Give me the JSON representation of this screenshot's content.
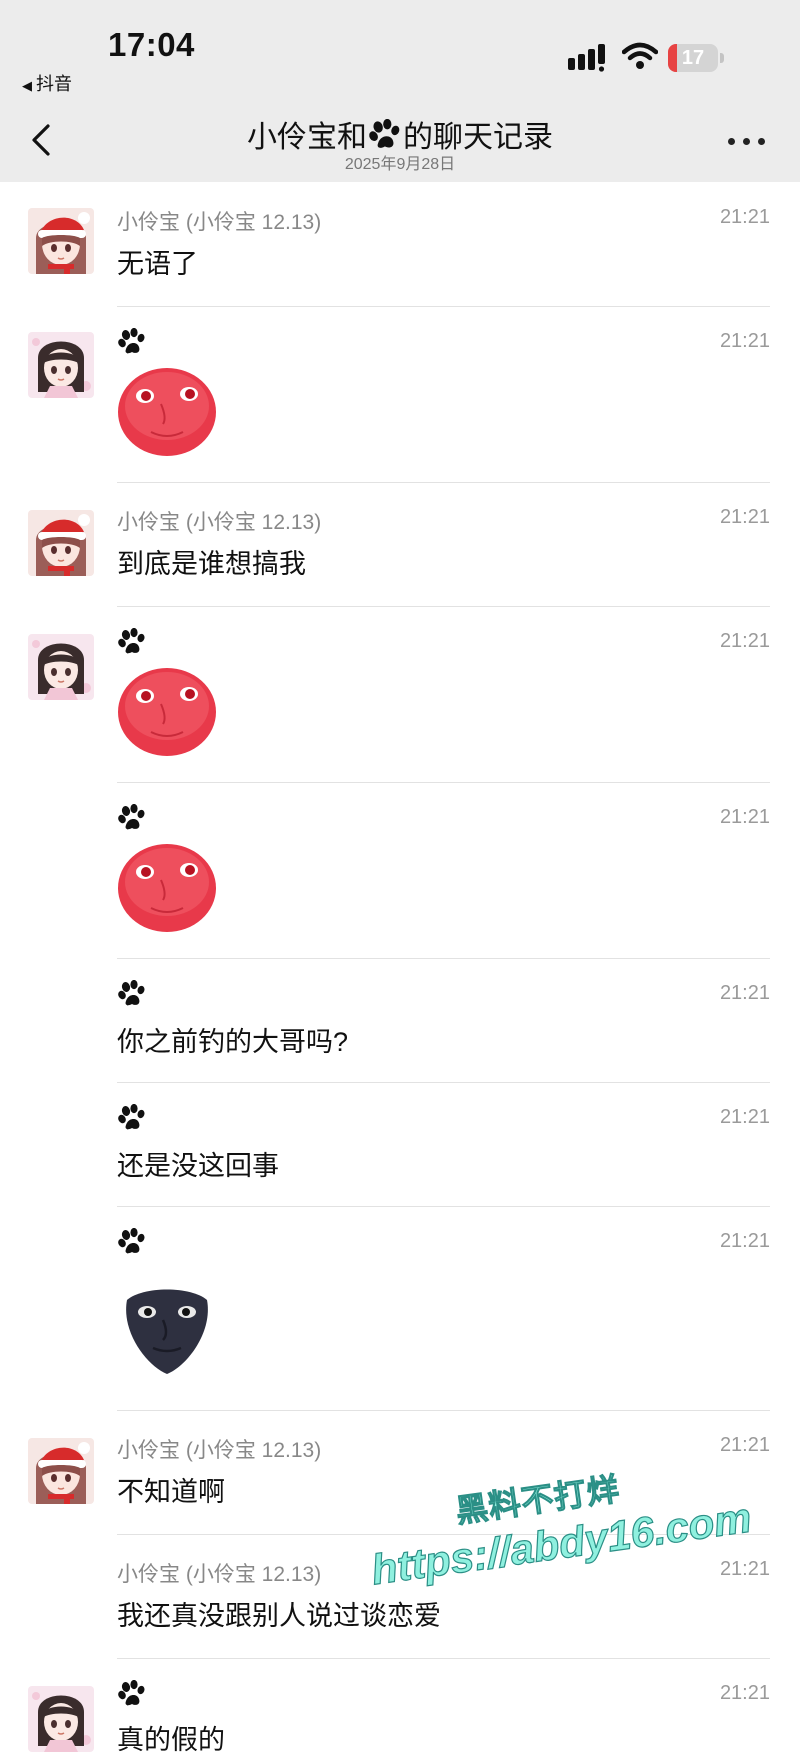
{
  "status_bar": {
    "time": "17:04",
    "back_app": "抖音",
    "battery": "17"
  },
  "nav": {
    "title_prefix": "小伶宝和",
    "title_suffix": "的聊天记录",
    "subtitle": "2025年9月28日"
  },
  "messages": [
    {
      "sender": "小伶宝 (小伶宝 12.13)",
      "time": "21:21",
      "text": "无语了"
    },
    {
      "sender_icon": "paw-icon",
      "time": "21:21",
      "sticker": "red-moon-face-sticker"
    },
    {
      "sender": "小伶宝 (小伶宝 12.13)",
      "time": "21:21",
      "text": "到底是谁想搞我"
    },
    {
      "sender_icon": "paw-icon",
      "time": "21:21",
      "sticker": "red-moon-face-sticker"
    },
    {
      "sender_icon": "paw-icon",
      "time": "21:21",
      "sticker": "red-moon-face-sticker"
    },
    {
      "sender_icon": "paw-icon",
      "time": "21:21",
      "text": "你之前钓的大哥吗?"
    },
    {
      "sender_icon": "paw-icon",
      "time": "21:21",
      "text": "还是没这回事"
    },
    {
      "sender_icon": "paw-icon",
      "time": "21:21",
      "sticker": "dark-moon-face-sticker"
    },
    {
      "sender": "小伶宝 (小伶宝 12.13)",
      "time": "21:21",
      "text": "不知道啊"
    },
    {
      "sender": "小伶宝 (小伶宝 12.13)",
      "time": "21:21",
      "text": "我还真没跟别人说过谈恋爱"
    },
    {
      "sender_icon": "paw-icon",
      "time": "21:21",
      "text": "真的假的"
    }
  ],
  "watermark": {
    "line1": "黑料不打烊",
    "line2": "https://abdy16.com"
  },
  "colors": {
    "header_bg": "#ececec",
    "battery_low": "#e74343",
    "sticker_red": "#e8394a",
    "sticker_dark": "#2e3040",
    "watermark": "#8ff0df"
  }
}
